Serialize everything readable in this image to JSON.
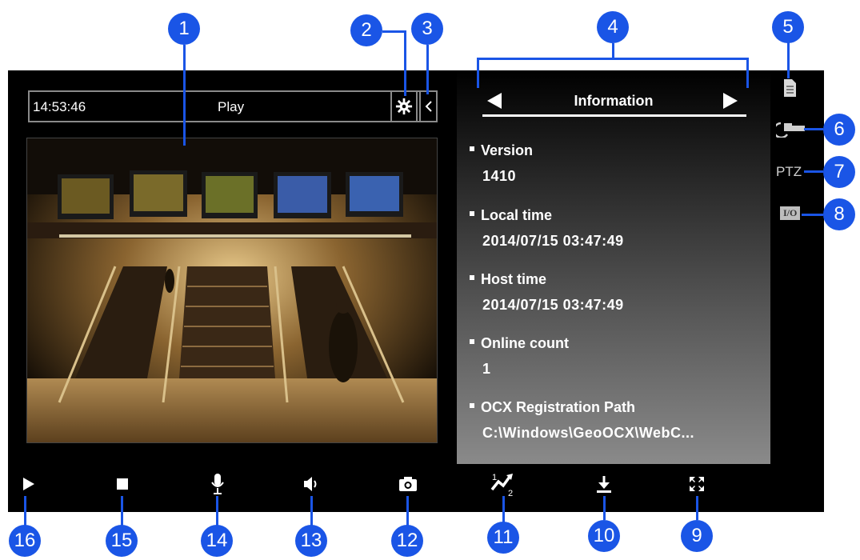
{
  "player": {
    "time": "14:53:46",
    "mode": "Play"
  },
  "info_panel": {
    "title": "Information",
    "items": [
      {
        "label": "Version",
        "value": "1410"
      },
      {
        "label": "Local time",
        "value": "2014/07/15 03:47:49"
      },
      {
        "label": "Host time",
        "value": "2014/07/15 03:47:49"
      },
      {
        "label": "Online count",
        "value": "1"
      },
      {
        "label": "OCX Registration Path",
        "value": "C:\\Windows\\GeoOCX\\WebC..."
      }
    ]
  },
  "side": {
    "ptz_label": "PTZ",
    "io_label": "I/O"
  },
  "toolbar": {
    "speed_numerator": "1",
    "speed_denominator": "2"
  },
  "callouts": [
    "1",
    "2",
    "3",
    "4",
    "5",
    "6",
    "7",
    "8",
    "9",
    "10",
    "11",
    "12",
    "13",
    "14",
    "15",
    "16"
  ],
  "colors": {
    "callout": "#1a55e6",
    "panel_bg": "#000000",
    "border": "#8a8a8a"
  },
  "icons": [
    "settings-gear-icon",
    "collapse-arrow-icon",
    "prev-arrow-icon",
    "next-arrow-icon",
    "document-icon",
    "camera-link-icon",
    "play-icon",
    "stop-icon",
    "microphone-icon",
    "speaker-icon",
    "snapshot-camera-icon",
    "speed-icon",
    "download-icon",
    "fullscreen-icon"
  ]
}
